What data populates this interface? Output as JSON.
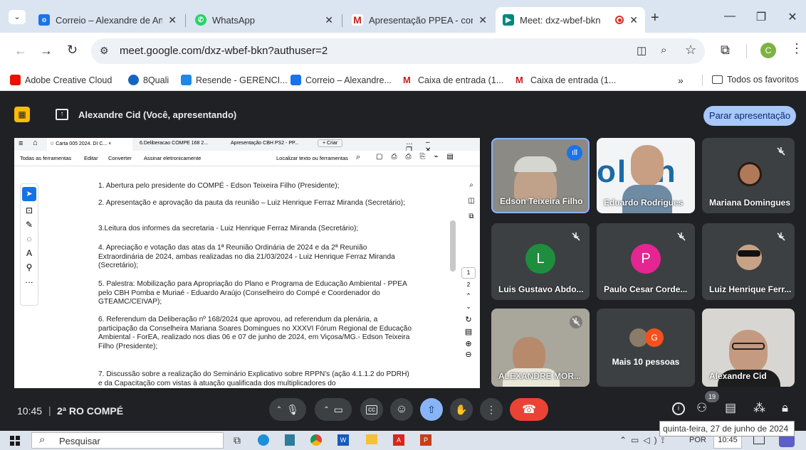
{
  "browser": {
    "tabs": [
      {
        "title": "Correio – Alexandre de An",
        "color": "#1a73e8",
        "icon": "outlook-icon"
      },
      {
        "title": "WhatsApp",
        "color": "#25d366",
        "icon": "whatsapp-icon"
      },
      {
        "title": "Apresentação PPEA - com",
        "color": "#c5221f",
        "icon": "gmail-icon"
      },
      {
        "title": "Meet: dxz-wbef-bkn",
        "color": "#00897b",
        "icon": "meet-icon"
      }
    ],
    "url": "meet.google.com/dxz-wbef-bkn?authuser=2",
    "profile_initial": "C",
    "bookmarks": [
      "Adobe Creative Cloud",
      "8Quali",
      "Resende - GERENCI...",
      "Correio – Alexandre...",
      "Caixa de entrada (1...",
      "Caixa de entrada (1..."
    ],
    "bookmarks_more": "»",
    "all_favorites": "Todos os favoritos"
  },
  "meet": {
    "presenter_label": "Alexandre Cid (Você, apresentando)",
    "stop_presenting": "Parar apresentação",
    "time": "10:45",
    "separator": "|",
    "meeting_name": "2ª RO COMPÉ",
    "participants_badge": "19",
    "date_tooltip": "quinta-feira, 27 de junho de 2024",
    "tiles": [
      {
        "name": "Edson Teixeira Filho",
        "type": "video"
      },
      {
        "name": "Eduardo Rodrigues",
        "type": "video"
      },
      {
        "name": "Mariana Domingues",
        "type": "photo"
      },
      {
        "name": "Luis Gustavo Abdo...",
        "type": "avatar",
        "initial": "L",
        "color": "#1e8e3e"
      },
      {
        "name": "Paulo Cesar Corde...",
        "type": "avatar",
        "initial": "P",
        "color": "#e52592"
      },
      {
        "name": "Luiz Henrique Ferr...",
        "type": "photo"
      },
      {
        "name": "ALEXANDRE MOR...",
        "type": "video"
      },
      {
        "name": "Mais 10 pessoas",
        "type": "more",
        "initial": "G"
      },
      {
        "name": "Alexandre Cid",
        "type": "video"
      }
    ]
  },
  "pdf": {
    "tabs": [
      "Carta 005 2024. DI C...",
      "6.Deliberacao COMPE 168 2...",
      "Apresentação CBH PS2 - PP...",
      "+ Criar"
    ],
    "menu": [
      "Todas as ferramentas",
      "Editar",
      "Converter",
      "Assinar eletronicamente"
    ],
    "search": "Localizar texto ou ferramentas",
    "page_numbers": [
      "1",
      "2"
    ],
    "items": [
      "1. Abertura pelo presidente do COMPÉ - Edson Teixeira Filho (Presidente);",
      "2. Apresentação e aprovação da pauta da reunião – Luiz Henrique Ferraz Miranda (Secretário);",
      "3.Leitura dos informes da secretaria - Luiz Henrique Ferraz Miranda (Secretário);",
      "4. Apreciação e votação das atas da 1ª Reunião Ordinária de 2024 e da 2ª Reunião Extraordinária de 2024, ambas realizadas no dia 21/03/2024 - Luiz Henrique Ferraz Miranda (Secretário);",
      "5. Palestra: Mobilização para Apropriação do Plano e Programa de Educação Ambiental - PPEA pelo CBH Pomba e Muriaé - Eduardo Araújo (Conselheiro do Compé e Coordenador do GTEAMC/CEIVAP);",
      "6. Referendum da Deliberação nº 168/2024 que aprovou, ad referendum da plenária, a participação da Conselheira Mariana Soares Domingues no XXXVI Fórum Regional de Educação Ambiental - ForEA, realizado nos dias 06 e 07 de junho de 2024, em Viçosa/MG.- Edson Teixeira Filho (Presidente);",
      "7. Discussão sobre a realização do Seminário Explicativo sobre RPPN's (ação 4.1.1.2 do PDRH) e da Capacitação com vistas à atuação qualificada dos multiplicadores do"
    ]
  },
  "taskbar": {
    "search": "Pesquisar",
    "lang": "POR",
    "time": "10:45"
  }
}
